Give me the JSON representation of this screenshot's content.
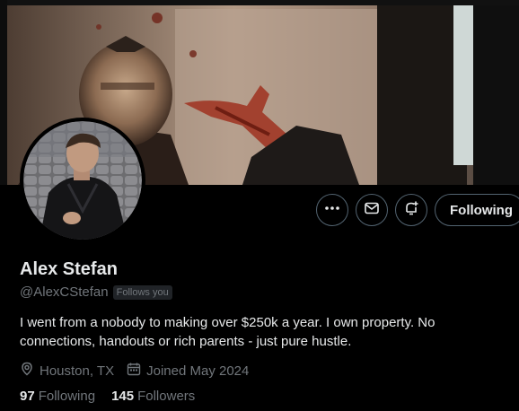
{
  "profile": {
    "name": "Alex Stefan",
    "handle": "@AlexCStefan",
    "follows_you_badge": "Follows you",
    "bio": "I went from a nobody to making over $250k a year. I own property. No connections, handouts or rich parents - just pure hustle.",
    "location": "Houston, TX",
    "joined": "Joined May 2024",
    "following_count": "97",
    "following_label": "Following",
    "followers_count": "145",
    "followers_label": "Followers"
  },
  "actions": {
    "more_icon": "more-icon",
    "message_icon": "mail-icon",
    "notify_icon": "bell-plus-icon",
    "follow_button_label": "Following"
  },
  "colors": {
    "background": "#000000",
    "text_primary": "#e7e9ea",
    "text_secondary": "#71767b",
    "button_border": "#536471"
  }
}
